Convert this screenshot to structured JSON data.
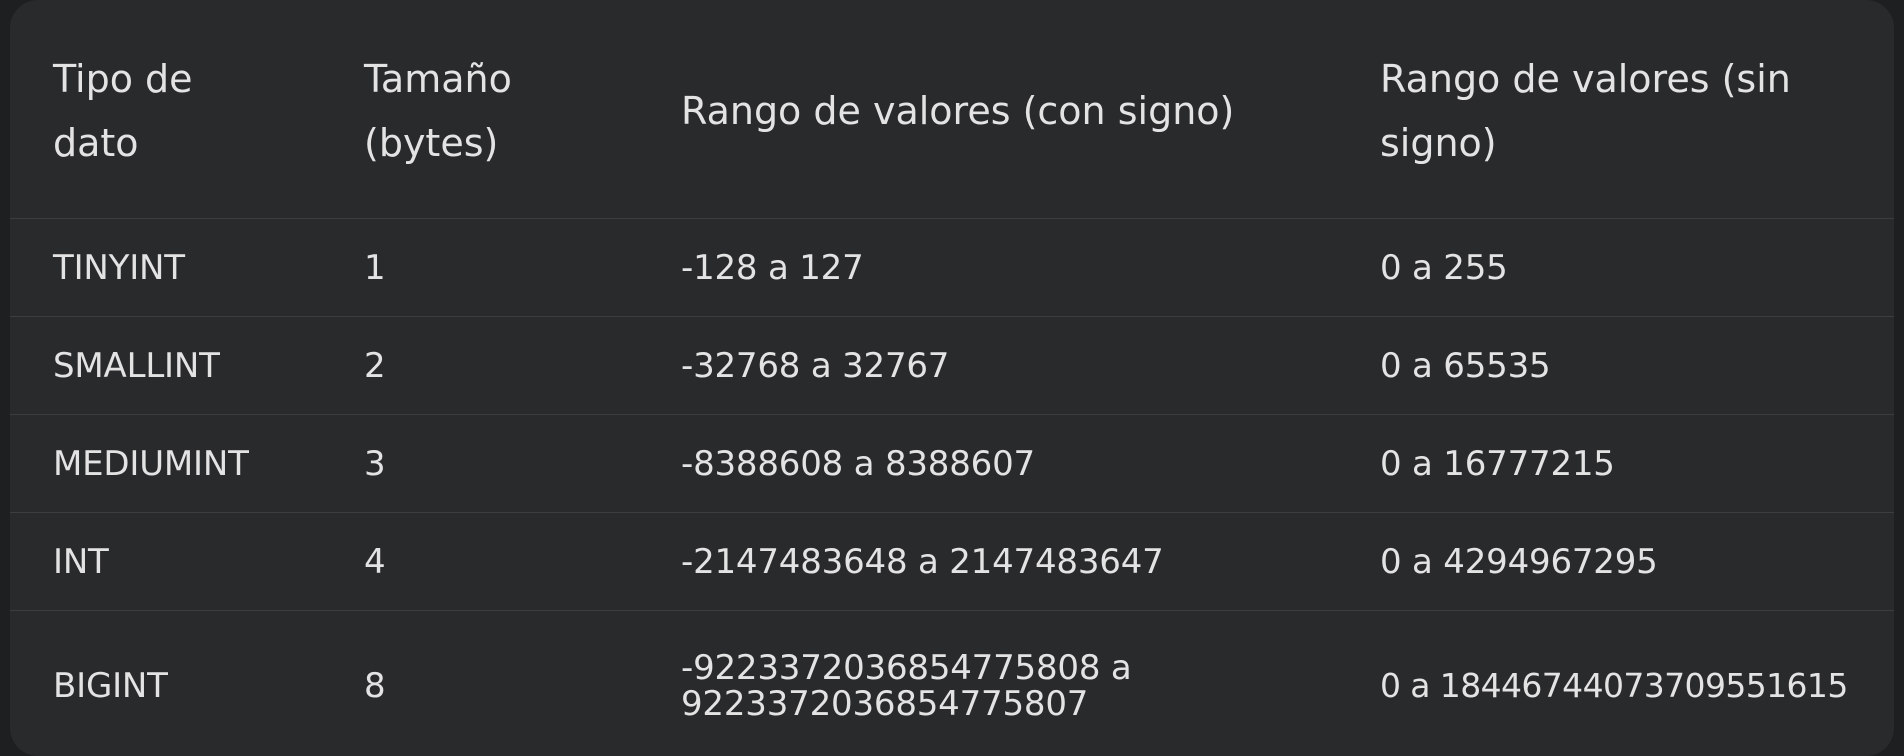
{
  "table": {
    "headers": [
      "Tipo de dato",
      "Tamaño (bytes)",
      "Rango de valores (con signo)",
      "Rango de valores (sin signo)"
    ],
    "rows": [
      [
        "TINYINT",
        "1",
        "-128 a 127",
        "0 a 255"
      ],
      [
        "SMALLINT",
        "2",
        "-32768 a 32767",
        "0 a 65535"
      ],
      [
        "MEDIUMINT",
        "3",
        "-8388608 a 8388607",
        "0 a 16777215"
      ],
      [
        "INT",
        "4",
        "-2147483648 a 2147483647",
        "0 a 4294967295"
      ],
      [
        "BIGINT",
        "8",
        "-9223372036854775808 a 9223372036854775807",
        "0 a 18446744073709551615"
      ]
    ]
  }
}
